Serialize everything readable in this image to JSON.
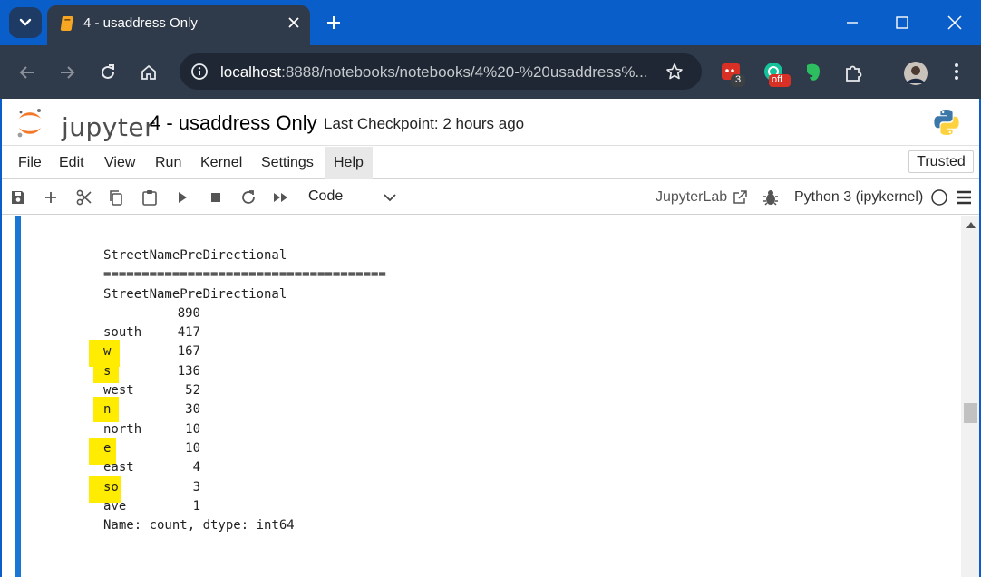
{
  "browser": {
    "tab_title": "4 - usaddress Only",
    "url_host": "localhost",
    "url_path": ":8888/notebooks/notebooks/4%20-%20usaddress%...",
    "extension_badge_count": "3",
    "extension_badge_off": "off"
  },
  "jupyter": {
    "logo_text": "jupyter",
    "notebook_title": "4 - usaddress Only",
    "checkpoint": "Last Checkpoint: 2 hours ago",
    "trusted_label": "Trusted",
    "menu": [
      "File",
      "Edit",
      "View",
      "Run",
      "Kernel",
      "Settings",
      "Help"
    ],
    "active_menu": "Help",
    "cell_type": "Code",
    "jupyterlab_label": "JupyterLab",
    "kernel_label": "Python 3 (ipykernel)"
  },
  "output": {
    "header": "StreetNamePreDirectional",
    "separator": "=====================================",
    "series_name": "StreetNamePreDirectional",
    "rows": [
      {
        "label": "",
        "count": "890",
        "highlighted": false
      },
      {
        "label": "south",
        "count": "417",
        "highlighted": false
      },
      {
        "label": "w",
        "count": "167",
        "highlighted": true
      },
      {
        "label": "s",
        "count": "136",
        "highlighted": true
      },
      {
        "label": "west",
        "count": "52",
        "highlighted": false
      },
      {
        "label": "n",
        "count": "30",
        "highlighted": true
      },
      {
        "label": "north",
        "count": "10",
        "highlighted": false
      },
      {
        "label": "e",
        "count": "10",
        "highlighted": true
      },
      {
        "label": "east",
        "count": "4",
        "highlighted": false
      },
      {
        "label": "so",
        "count": "3",
        "highlighted": true
      },
      {
        "label": "ave",
        "count": "1",
        "highlighted": false
      }
    ],
    "footer": "Name: count, dtype: int64"
  },
  "colors": {
    "titlebar": "#0a5ec9",
    "chrome_dark": "#2f3a4a",
    "cell_bar": "#1976d2",
    "highlight": "#ffec00",
    "jupyter_orange": "#f37726"
  },
  "icons": [
    "tab-search-icon",
    "notebook-favicon-icon",
    "close-icon",
    "plus-icon",
    "minimize-icon",
    "maximize-icon",
    "window-close-icon",
    "back-icon",
    "forward-icon",
    "reload-icon",
    "home-icon",
    "info-icon",
    "star-icon",
    "puzzle-icon",
    "avatar",
    "kebab-menu-icon",
    "save-icon",
    "cut-icon",
    "copy-icon",
    "paste-icon",
    "run-icon",
    "stop-icon",
    "restart-icon",
    "run-all-icon",
    "external-link-icon",
    "bug-icon",
    "kernel-status-icon",
    "hamburger-icon"
  ]
}
